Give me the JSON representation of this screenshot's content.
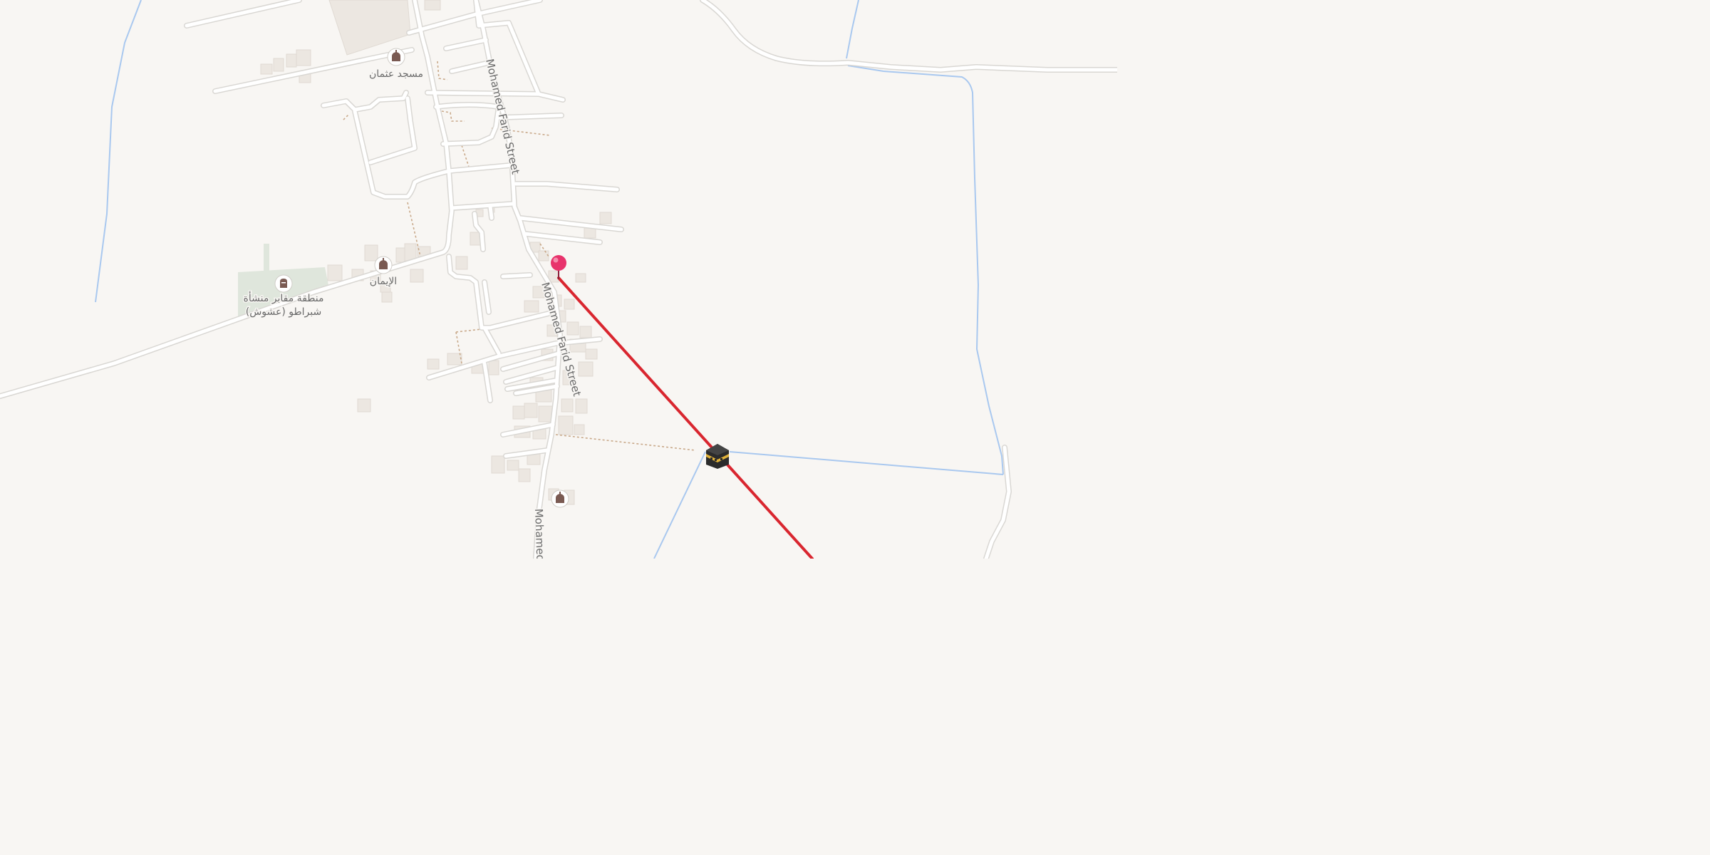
{
  "map": {
    "colors": {
      "background": "#f8f6f3",
      "road": "#ffffff",
      "road_casing": "#d9d7d3",
      "building": "#ece7e1",
      "water": "#a9c8ef",
      "cemetery": "#dfe6dc",
      "path": "#c9a98a",
      "qibla_line": "#d9262f",
      "pin": "#e8336c"
    },
    "streets": [
      {
        "name": "Mohamed Farid Street"
      },
      {
        "name": "Mohamed Farid Street"
      },
      {
        "name": "Mohamed"
      }
    ],
    "pois": [
      {
        "name": "مسجد عثمان",
        "icon": "mosque-icon"
      },
      {
        "name": "الإيمان",
        "icon": "mosque-icon"
      },
      {
        "name_line1": "منطقة مقابر منشأة",
        "name_line2": "شبراطو (عشوش)",
        "icon": "cemetery-icon"
      },
      {
        "name": "",
        "icon": "mosque-icon"
      }
    ],
    "markers": {
      "location_pin": "map-pin-icon",
      "kaaba": "kaaba-icon"
    }
  }
}
